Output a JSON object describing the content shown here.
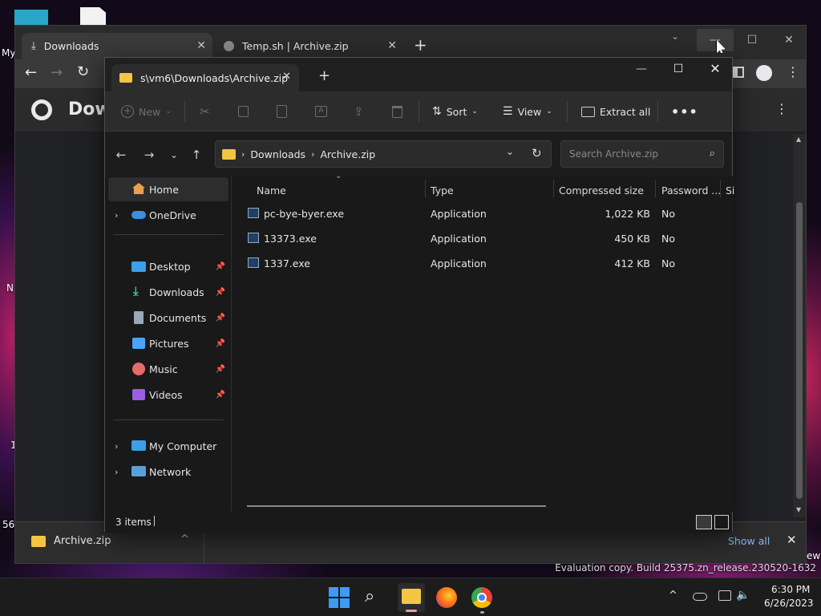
{
  "desktop": {
    "labels": [
      "My",
      "N",
      "1",
      "56y",
      "ew"
    ]
  },
  "chrome": {
    "tabs": [
      {
        "label": "Downloads"
      },
      {
        "label": "Temp.sh | Archive.zip"
      }
    ],
    "page_heading": "Dow",
    "download_shelf": {
      "file": "Archive.zip",
      "show_all": "Show all"
    }
  },
  "explorer": {
    "tab_title": "s\\vm6\\Downloads\\Archive.zip",
    "toolbar": {
      "new": "New",
      "sort": "Sort",
      "view": "View",
      "extract_all": "Extract all"
    },
    "address": {
      "crumbs": [
        "Downloads",
        "Archive.zip"
      ]
    },
    "search_placeholder": "Search Archive.zip",
    "sidebar": {
      "home": "Home",
      "onedrive": "OneDrive",
      "quick": [
        {
          "label": "Desktop"
        },
        {
          "label": "Downloads"
        },
        {
          "label": "Documents"
        },
        {
          "label": "Pictures"
        },
        {
          "label": "Music"
        },
        {
          "label": "Videos"
        }
      ],
      "my_computer": "My Computer",
      "network": "Network"
    },
    "columns": [
      "Name",
      "Type",
      "Compressed size",
      "Password ...",
      "Si"
    ],
    "files": [
      {
        "name": "pc-bye-byer.exe",
        "type": "Application",
        "size": "1,022 KB",
        "password": "No"
      },
      {
        "name": "13373.exe",
        "type": "Application",
        "size": "450 KB",
        "password": "No"
      },
      {
        "name": "1337.exe",
        "type": "Application",
        "size": "412 KB",
        "password": "No"
      }
    ],
    "status": "3 items"
  },
  "taskbar": {
    "time": "6:30 PM",
    "date": "6/26/2023"
  },
  "watermark": "Evaluation copy. Build 25375.zn_release.230520-1632",
  "colors": {
    "accent_blue": "#4aa3ff",
    "folder_yellow": "#f4c542",
    "chrome_dark": "#202124"
  }
}
